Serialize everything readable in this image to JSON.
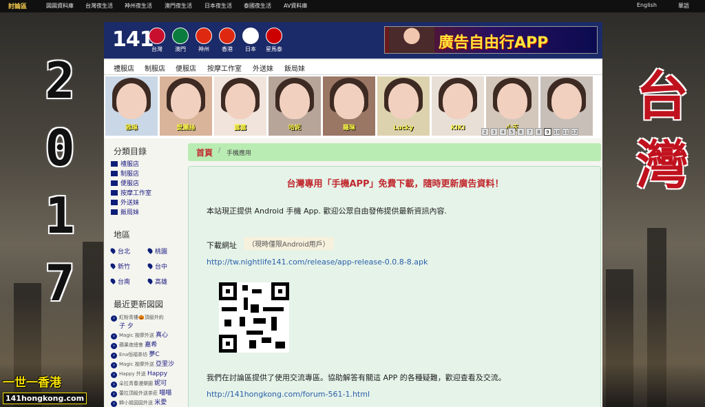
{
  "topnav": {
    "brand": "討論區",
    "items": [
      "図図資料庫",
      "台灣夜生活",
      "神州夜生活",
      "澳門夜生活",
      "日本夜生活",
      "泰國夜生活",
      "AV資料庫"
    ],
    "lang_en": "English",
    "lang_zh": "華語"
  },
  "decor": {
    "year_digits": [
      "2",
      "0",
      "1",
      "7"
    ],
    "side_title_chars": [
      "台",
      "灣"
    ],
    "logo_cn": "一世一香港",
    "logo_en": "141hongkong.com"
  },
  "header": {
    "logo_number": "141",
    "flags": [
      {
        "label": "台灣",
        "color": "#c8102e"
      },
      {
        "label": "澳門",
        "color": "#0a7d3e"
      },
      {
        "label": "神州",
        "color": "#de2910"
      },
      {
        "label": "香港",
        "color": "#de2910"
      },
      {
        "label": "日本",
        "color": "#ffffff"
      },
      {
        "label": "星馬泰",
        "color": "#cc0001"
      }
    ],
    "ad_text": "廣告自由行APP"
  },
  "categories": [
    "禮服店",
    "制服店",
    "便服店",
    "按摩工作室",
    "外送妹",
    "飯局妹"
  ],
  "thumbnails": [
    {
      "name": "雅琳"
    },
    {
      "name": "愛麗絲"
    },
    {
      "name": "露露"
    },
    {
      "name": "哈妮"
    },
    {
      "name": "羅琳"
    },
    {
      "name": "Lucky"
    },
    {
      "name": "KIKI"
    },
    {
      "name": "小玉"
    },
    {
      "name": ""
    }
  ],
  "pager": [
    "2",
    "3",
    "4",
    "5",
    "6",
    "7",
    "8",
    "9",
    "10",
    "11",
    "12"
  ],
  "pager_current": "9",
  "sidebar": {
    "categories_title": "分類目錄",
    "categories": [
      "禮服店",
      "制服店",
      "便服店",
      "按摩工作室",
      "外送妹",
      "飯局妹"
    ],
    "regions_title": "地區",
    "regions": [
      "台北",
      "桃園",
      "新竹",
      "台中",
      "台南",
      "高雄"
    ],
    "updates_title": "最近更新図図",
    "updates": [
      {
        "shop": "紅粉青樓🎃頂級外約",
        "name": "子 夕"
      },
      {
        "shop": "Magic 按摩外送",
        "name": "真心"
      },
      {
        "shop": "蘋果夜總會",
        "name": "嘉希"
      },
      {
        "shop": "Ena恒福茶坊",
        "name": "夢C"
      },
      {
        "shop": "Magic 按摩外送",
        "name": "亞里沙"
      },
      {
        "shop": "Happy 外送",
        "name": "Happy"
      },
      {
        "shop": "朵拉青春漫樂園",
        "name": "妮可"
      },
      {
        "shop": "蕾拉頂級外送茶莊",
        "name": "喵喵"
      },
      {
        "shop": "韓小姐図図外送",
        "name": "米愛"
      }
    ]
  },
  "breadcrumb": {
    "home": "首頁",
    "separator": "/",
    "current": "手機應用"
  },
  "content": {
    "headline": "台灣專用「手機APP」免費下載，隨時更新廣告資料！",
    "intro": "本站現正提供 Android 手機 App. 歡迎公眾自由發佈提供最新資訊內容.",
    "download_label": "下載網址",
    "download_note": "（現時僅限Android用戶）",
    "apk_url": "http://tw.nightlife141.com/release/app-release-0.0.8-8.apk",
    "forum_text": "我們在討論區提供了使用交流專區。協助解答有關這 APP 的各種疑難，歡迎查看及交流。",
    "forum_url": "http://141hongkong.com/forum-561-1.html"
  }
}
